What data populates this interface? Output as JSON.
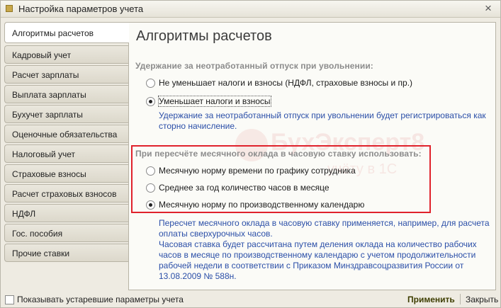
{
  "window": {
    "title": "Настройка параметров учета",
    "close_glyph": "×"
  },
  "tabs": [
    {
      "label": "Алгоритмы расчетов",
      "active": true
    },
    {
      "label": "Кадровый учет"
    },
    {
      "label": "Расчет зарплаты"
    },
    {
      "label": "Выплата зарплаты"
    },
    {
      "label": "Бухучет зарплаты"
    },
    {
      "label": "Оценочные обязательства"
    },
    {
      "label": "Налоговый учет"
    },
    {
      "label": "Страховые взносы"
    },
    {
      "label": "Расчет страховых взносов"
    },
    {
      "label": "НДФЛ"
    },
    {
      "label": "Гос. пособия"
    },
    {
      "label": "Прочие ставки"
    }
  ],
  "panel": {
    "heading": "Алгоритмы расчетов",
    "section1": {
      "label": "Удержание за неотработанный отпуск при увольнении:",
      "options": [
        {
          "label": "Не уменьшает налоги и взносы (НДФЛ, страховые взносы и пр.)",
          "checked": false
        },
        {
          "label": "Уменьшает налоги и взносы",
          "checked": true
        }
      ],
      "note_lines": [
        "Удержание за неотработанный отпуск при увольнении будет регистрироваться как",
        "сторно начисление."
      ]
    },
    "section2": {
      "label": "При пересчёте месячного оклада в часовую ставку использовать:",
      "options": [
        {
          "label": "Месячную норму времени по графику сотрудника",
          "checked": false
        },
        {
          "label": "Среднее за год количество часов в месяце",
          "checked": false
        },
        {
          "label": "Месячную норму по производственному календарю",
          "checked": true
        }
      ],
      "note_lines": [
        "Пересчет месячного оклада в часовую ставку применяется, например, для расчета",
        "оплаты сверхурочных часов.",
        "Часовая ставка будет рассчитана путем деления оклада на количество рабочих",
        "часов в месяце по производственному календарю с учетом продолжительности",
        "рабочей недели в соответствии с Приказом Минздравсоцразвития России от",
        "13.08.2009 № 588н."
      ]
    }
  },
  "watermark": {
    "title": "БухЭксперт8",
    "subtitle": "учёту в 1С"
  },
  "footer": {
    "checkbox_label": "Показывать устаревшие параметры учета",
    "checkbox_checked": false,
    "apply_label": "Применить",
    "close_label": "Закрыть"
  },
  "colors": {
    "highlight_border": "#e0222c",
    "note_text": "#2b4fa8",
    "section_label": "#8c8c8c"
  }
}
